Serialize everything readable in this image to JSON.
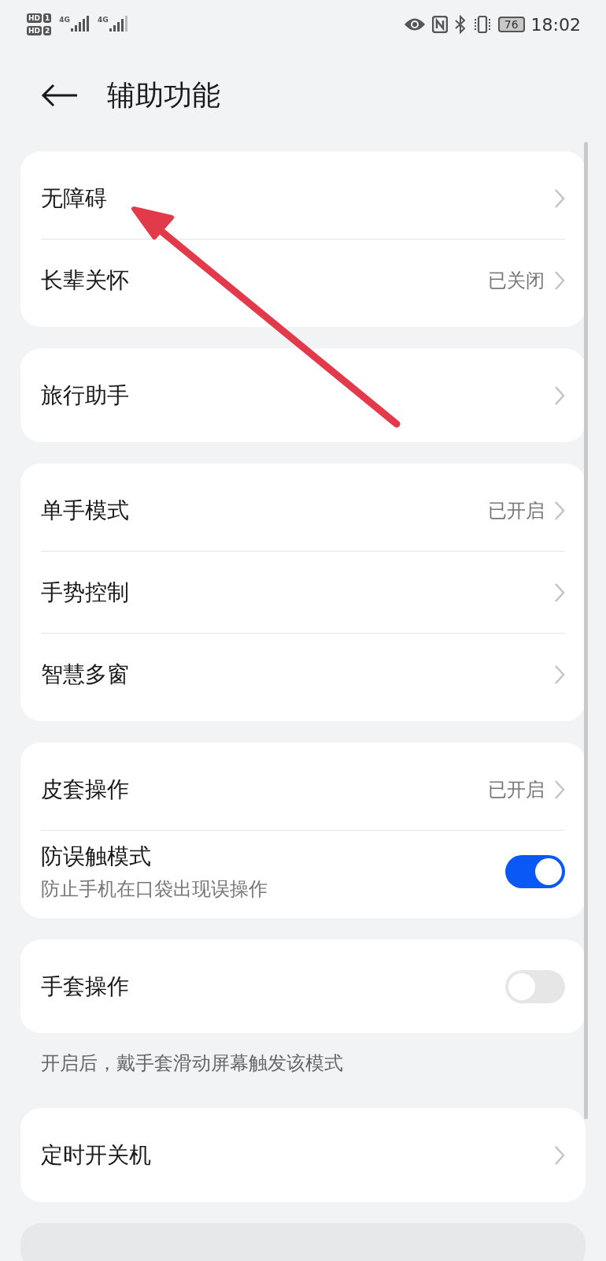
{
  "status_bar": {
    "sims": [
      {
        "tag": "HD",
        "slot": "1"
      },
      {
        "tag": "HD",
        "slot": "2"
      }
    ],
    "networks": [
      "4G",
      "4G"
    ],
    "battery": "76",
    "time": "18:02"
  },
  "header": {
    "title": "辅助功能"
  },
  "groups": [
    {
      "items": [
        {
          "kind": "link",
          "title": "无障碍"
        },
        {
          "kind": "link",
          "title": "长辈关怀",
          "value": "已关闭"
        }
      ]
    },
    {
      "items": [
        {
          "kind": "link",
          "title": "旅行助手"
        }
      ]
    },
    {
      "items": [
        {
          "kind": "link",
          "title": "单手模式",
          "value": "已开启"
        },
        {
          "kind": "link",
          "title": "手势控制"
        },
        {
          "kind": "link",
          "title": "智慧多窗"
        }
      ]
    },
    {
      "items": [
        {
          "kind": "link",
          "title": "皮套操作",
          "value": "已开启"
        },
        {
          "kind": "switch",
          "title": "防误触模式",
          "subtitle": "防止手机在口袋出现误操作",
          "on": true
        }
      ]
    },
    {
      "items": [
        {
          "kind": "switch",
          "title": "手套操作",
          "on": false
        }
      ],
      "footnote": "开启后，戴手套滑动屏幕触发该模式"
    },
    {
      "items": [
        {
          "kind": "link",
          "title": "定时开关机"
        }
      ]
    }
  ],
  "annotation": {
    "kind": "arrow"
  }
}
